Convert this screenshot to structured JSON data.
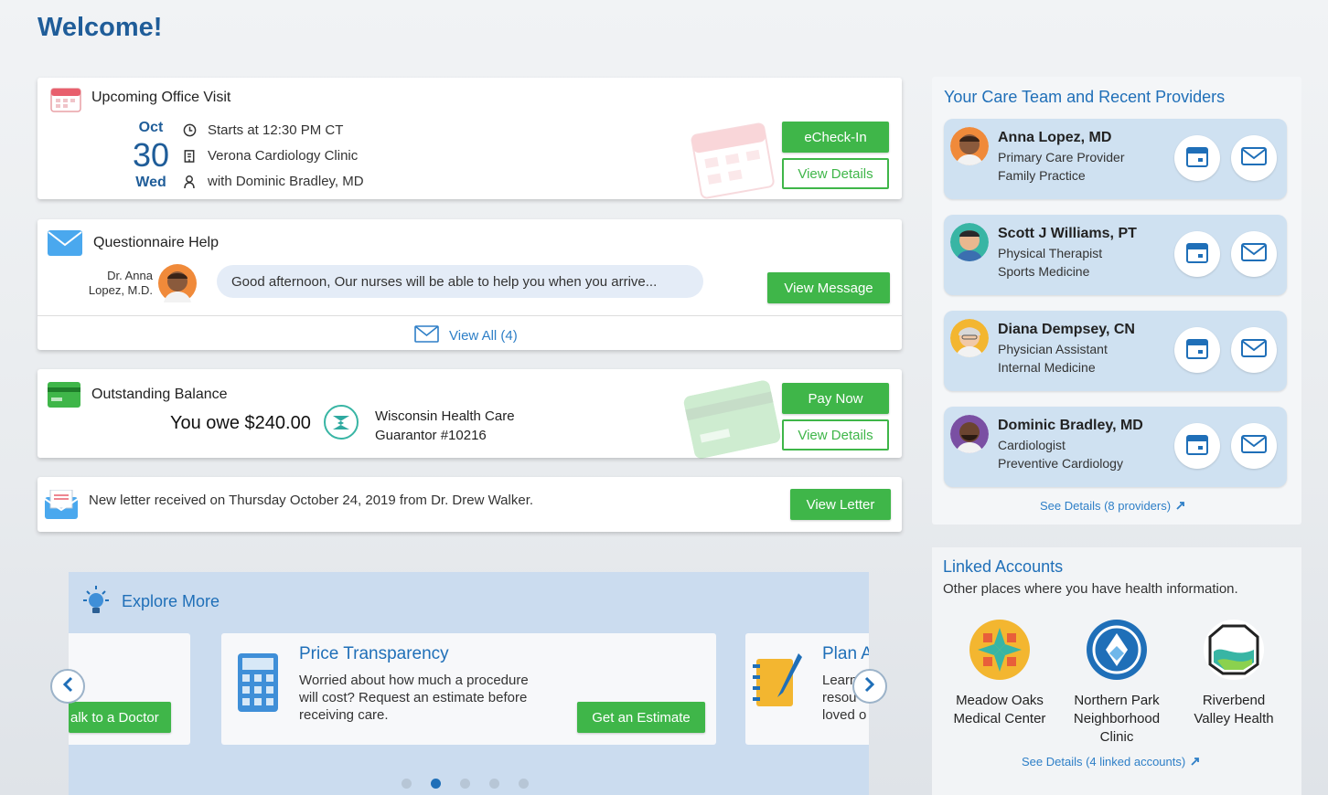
{
  "header": {
    "welcome": "Welcome!"
  },
  "visit": {
    "title": "Upcoming Office Visit",
    "month": "Oct",
    "day": "30",
    "weekday": "Wed",
    "time": "Starts at 12:30 PM CT",
    "location": "Verona Cardiology Clinic",
    "with": "with Dominic Bradley, MD",
    "echeckin_label": "eCheck-In",
    "details_label": "View Details"
  },
  "questionnaire": {
    "title": "Questionnaire Help",
    "doctor_line1": "Dr. Anna",
    "doctor_line2": "Lopez, M.D.",
    "message": "Good afternoon, Our nurses will be able to help you when you arrive...",
    "view_message_label": "View Message",
    "view_all_label": "View All (4)"
  },
  "balance": {
    "title": "Outstanding Balance",
    "amount_text": "You owe $240.00",
    "org": "Wisconsin Health Care",
    "guarantor": "Guarantor #10216",
    "pay_label": "Pay Now",
    "details_label": "View Details"
  },
  "letter": {
    "text": "New letter received on Thursday October 24, 2019 from Dr. Drew Walker.",
    "button_label": "View Letter"
  },
  "explore": {
    "title": "Explore More",
    "left_card_button": "alk to a Doctor",
    "price": {
      "title": "Price Transparency",
      "body_line1": "Worried about how much a procedure",
      "body_line2": "will cost? Request an estimate before",
      "body_line3": "receiving care.",
      "button": "Get an Estimate"
    },
    "plan": {
      "title": "Plan A",
      "line1": "Learn",
      "line2": "resou",
      "line3": "loved o"
    }
  },
  "care_team": {
    "title": "Your Care Team and Recent Providers",
    "providers": [
      {
        "name": "Anna Lopez, MD",
        "role": "Primary Care Provider",
        "dept": "Family Practice"
      },
      {
        "name": "Scott J Williams, PT",
        "role": "Physical Therapist",
        "dept": "Sports Medicine"
      },
      {
        "name": "Diana Dempsey, CN",
        "role": "Physician Assistant",
        "dept": "Internal Medicine"
      },
      {
        "name": "Dominic Bradley, MD",
        "role": "Cardiologist",
        "dept": "Preventive Cardiology"
      }
    ],
    "see_details": "See Details (8 providers)"
  },
  "linked": {
    "title": "Linked Accounts",
    "subtitle": "Other places where you have health information.",
    "accounts": [
      {
        "line1": "Meadow Oaks",
        "line2": "Medical Center",
        "line3": ""
      },
      {
        "line1": "Northern Park",
        "line2": "Neighborhood",
        "line3": "Clinic"
      },
      {
        "line1": "Riverbend",
        "line2": "Valley Health",
        "line3": ""
      }
    ],
    "see_details": "See Details (4 linked accounts)"
  },
  "colors": {
    "brand_blue": "#1f6fb8",
    "accent_green": "#3fb649",
    "provider_bg": "#cfe1f1"
  }
}
